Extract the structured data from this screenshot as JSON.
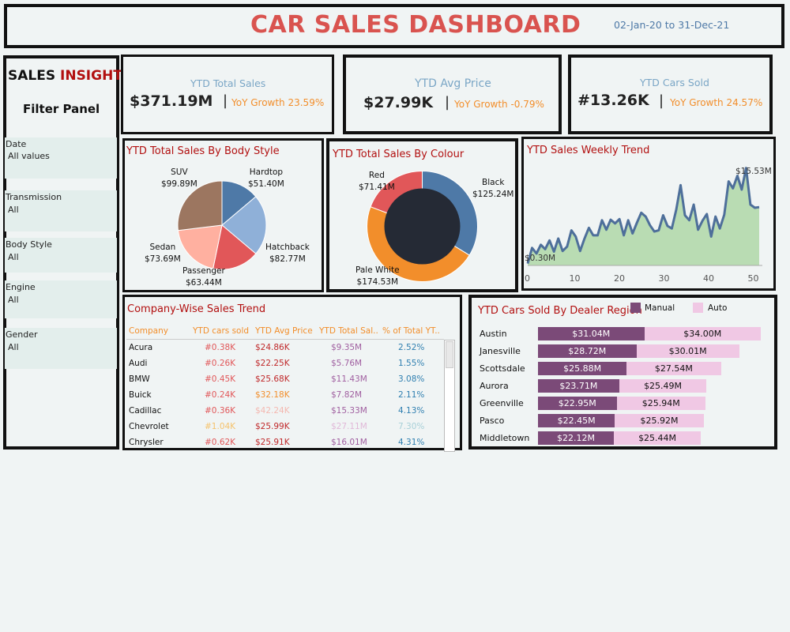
{
  "header": {
    "title": "CAR SALES DASHBOARD",
    "date_range": "02-Jan-20 to 31-Dec-21"
  },
  "filters": {
    "brand_left": "SALES ",
    "brand_right": "INSIGHT",
    "panel_title": "Filter Panel",
    "items": [
      {
        "label": "Date",
        "value": "All values"
      },
      {
        "label": "Transmission",
        "value": "All"
      },
      {
        "label": "Body Style",
        "value": "All"
      },
      {
        "label": "Engine",
        "value": "All"
      },
      {
        "label": "Gender",
        "value": "All"
      }
    ]
  },
  "kpis": [
    {
      "label": "YTD Total Sales",
      "value": "$371.19M",
      "sep": "|",
      "yoy": "YoY Growth 23.59%"
    },
    {
      "label": "YTD Avg Price",
      "value": "$27.99K",
      "sep": "|",
      "yoy": "YoY Growth -0.79%"
    },
    {
      "label": "YTD Cars Sold",
      "value": "#13.26K",
      "sep": "|",
      "yoy": "YoY  Growth 24.57%"
    }
  ],
  "body_style": {
    "title": "YTD Total Sales By Body Style",
    "slices": [
      {
        "name": "Hardtop",
        "value": "$51.40M",
        "amount": 51.4,
        "color": "#4e79a7"
      },
      {
        "name": "Hatchback",
        "value": "$82.77M",
        "amount": 82.77,
        "color": "#8fb0d8"
      },
      {
        "name": "Passenger",
        "value": "$63.44M",
        "amount": 63.44,
        "color": "#e15759"
      },
      {
        "name": "Sedan",
        "value": "$73.69M",
        "amount": 73.69,
        "color": "#ffb0a0"
      },
      {
        "name": "SUV",
        "value": "$99.89M",
        "amount": 99.89,
        "color": "#9c7660"
      }
    ]
  },
  "colour": {
    "title": "YTD Total Sales By Colour",
    "slices": [
      {
        "name": "Black",
        "value": "$125.24M",
        "amount": 125.24,
        "color": "#4e79a7"
      },
      {
        "name": "Pale White",
        "value": "$174.53M",
        "amount": 174.53,
        "color": "#f28e2b"
      },
      {
        "name": "Red",
        "value": "$71.41M",
        "amount": 71.41,
        "color": "#e15759"
      }
    ],
    "center_color": "#252a35"
  },
  "weekly": {
    "title": "YTD Sales Weekly Trend",
    "max_label": "$15.53M",
    "min_label": "$0.30M",
    "ticks": [
      "0",
      "10",
      "20",
      "30",
      "40",
      "50"
    ]
  },
  "chart_data": {
    "type": "area",
    "xlabel": "",
    "ylabel": "",
    "xlim": [
      0,
      53
    ],
    "ylim": [
      0,
      16
    ],
    "x": [
      0,
      1,
      2,
      3,
      4,
      5,
      6,
      7,
      8,
      9,
      10,
      11,
      12,
      13,
      14,
      15,
      16,
      17,
      18,
      19,
      20,
      21,
      22,
      23,
      24,
      25,
      26,
      27,
      28,
      29,
      30,
      31,
      32,
      33,
      34,
      35,
      36,
      37,
      38,
      39,
      40,
      41,
      42,
      43,
      44,
      45,
      46,
      47,
      48,
      49,
      50,
      51,
      52,
      53
    ],
    "series": [
      {
        "values": [
          0.3,
          2.8,
          1.9,
          3.3,
          2.6,
          4.0,
          2.2,
          4.3,
          2.3,
          3.0,
          5.6,
          4.6,
          2.3,
          4.3,
          6.0,
          4.8,
          4.8,
          7.2,
          5.7,
          7.3,
          6.7,
          7.4,
          4.8,
          7.2,
          5.1,
          6.8,
          8.4,
          7.8,
          6.4,
          5.4,
          5.6,
          8.0,
          6.3,
          5.9,
          8.9,
          12.8,
          8.0,
          7.2,
          9.7,
          5.7,
          7.1,
          8.2,
          4.6,
          7.8,
          5.9,
          8.1,
          13.4,
          12.3,
          14.3,
          12.1,
          15.53,
          9.7,
          9.2,
          9.3
        ]
      }
    ]
  },
  "company_table": {
    "title": "Company-Wise Sales Trend",
    "columns": [
      "Company",
      "YTD cars sold",
      "YTD Avg Price",
      "YTD Total Sal..",
      "% of Total YT.."
    ],
    "rows": [
      [
        "Acura",
        "#0.38K",
        "$24.86K",
        "$9.35M",
        "2.52%"
      ],
      [
        "Audi",
        "#0.26K",
        "$22.25K",
        "$5.76M",
        "1.55%"
      ],
      [
        "BMW",
        "#0.45K",
        "$25.68K",
        "$11.43M",
        "3.08%"
      ],
      [
        "Buick",
        "#0.24K",
        "$32.18K",
        "$7.82M",
        "2.11%"
      ],
      [
        "Cadillac",
        "#0.36K",
        "$42.24K",
        "$15.33M",
        "4.13%"
      ],
      [
        "Chevrolet",
        "#1.04K",
        "$25.99K",
        "$27.11M",
        "7.30%"
      ],
      [
        "Chrysler",
        "#0.62K",
        "$25.91K",
        "$16.01M",
        "4.31%"
      ]
    ]
  },
  "dealer_region": {
    "title": "YTD Cars Sold By Dealer Region",
    "legend": [
      "Manual",
      "Auto"
    ],
    "colors": {
      "manual": "#7b4a78",
      "auto": "#f0c8e4"
    },
    "rows": [
      {
        "region": "Austin",
        "manual": "$31.04M",
        "auto": "$34.00M",
        "m": 31.04,
        "a": 34.0
      },
      {
        "region": "Janesville",
        "manual": "$28.72M",
        "auto": "$30.01M",
        "m": 28.72,
        "a": 30.01
      },
      {
        "region": "Scottsdale",
        "manual": "$25.88M",
        "auto": "$27.54M",
        "m": 25.88,
        "a": 27.54
      },
      {
        "region": "Aurora",
        "manual": "$23.71M",
        "auto": "$25.49M",
        "m": 23.71,
        "a": 25.49
      },
      {
        "region": "Greenville",
        "manual": "$22.95M",
        "auto": "$25.94M",
        "m": 22.95,
        "a": 25.94
      },
      {
        "region": "Pasco",
        "manual": "$22.45M",
        "auto": "$25.92M",
        "m": 22.45,
        "a": 25.92
      },
      {
        "region": "Middletown",
        "manual": "$22.12M",
        "auto": "$25.44M",
        "m": 22.12,
        "a": 25.44
      }
    ]
  }
}
